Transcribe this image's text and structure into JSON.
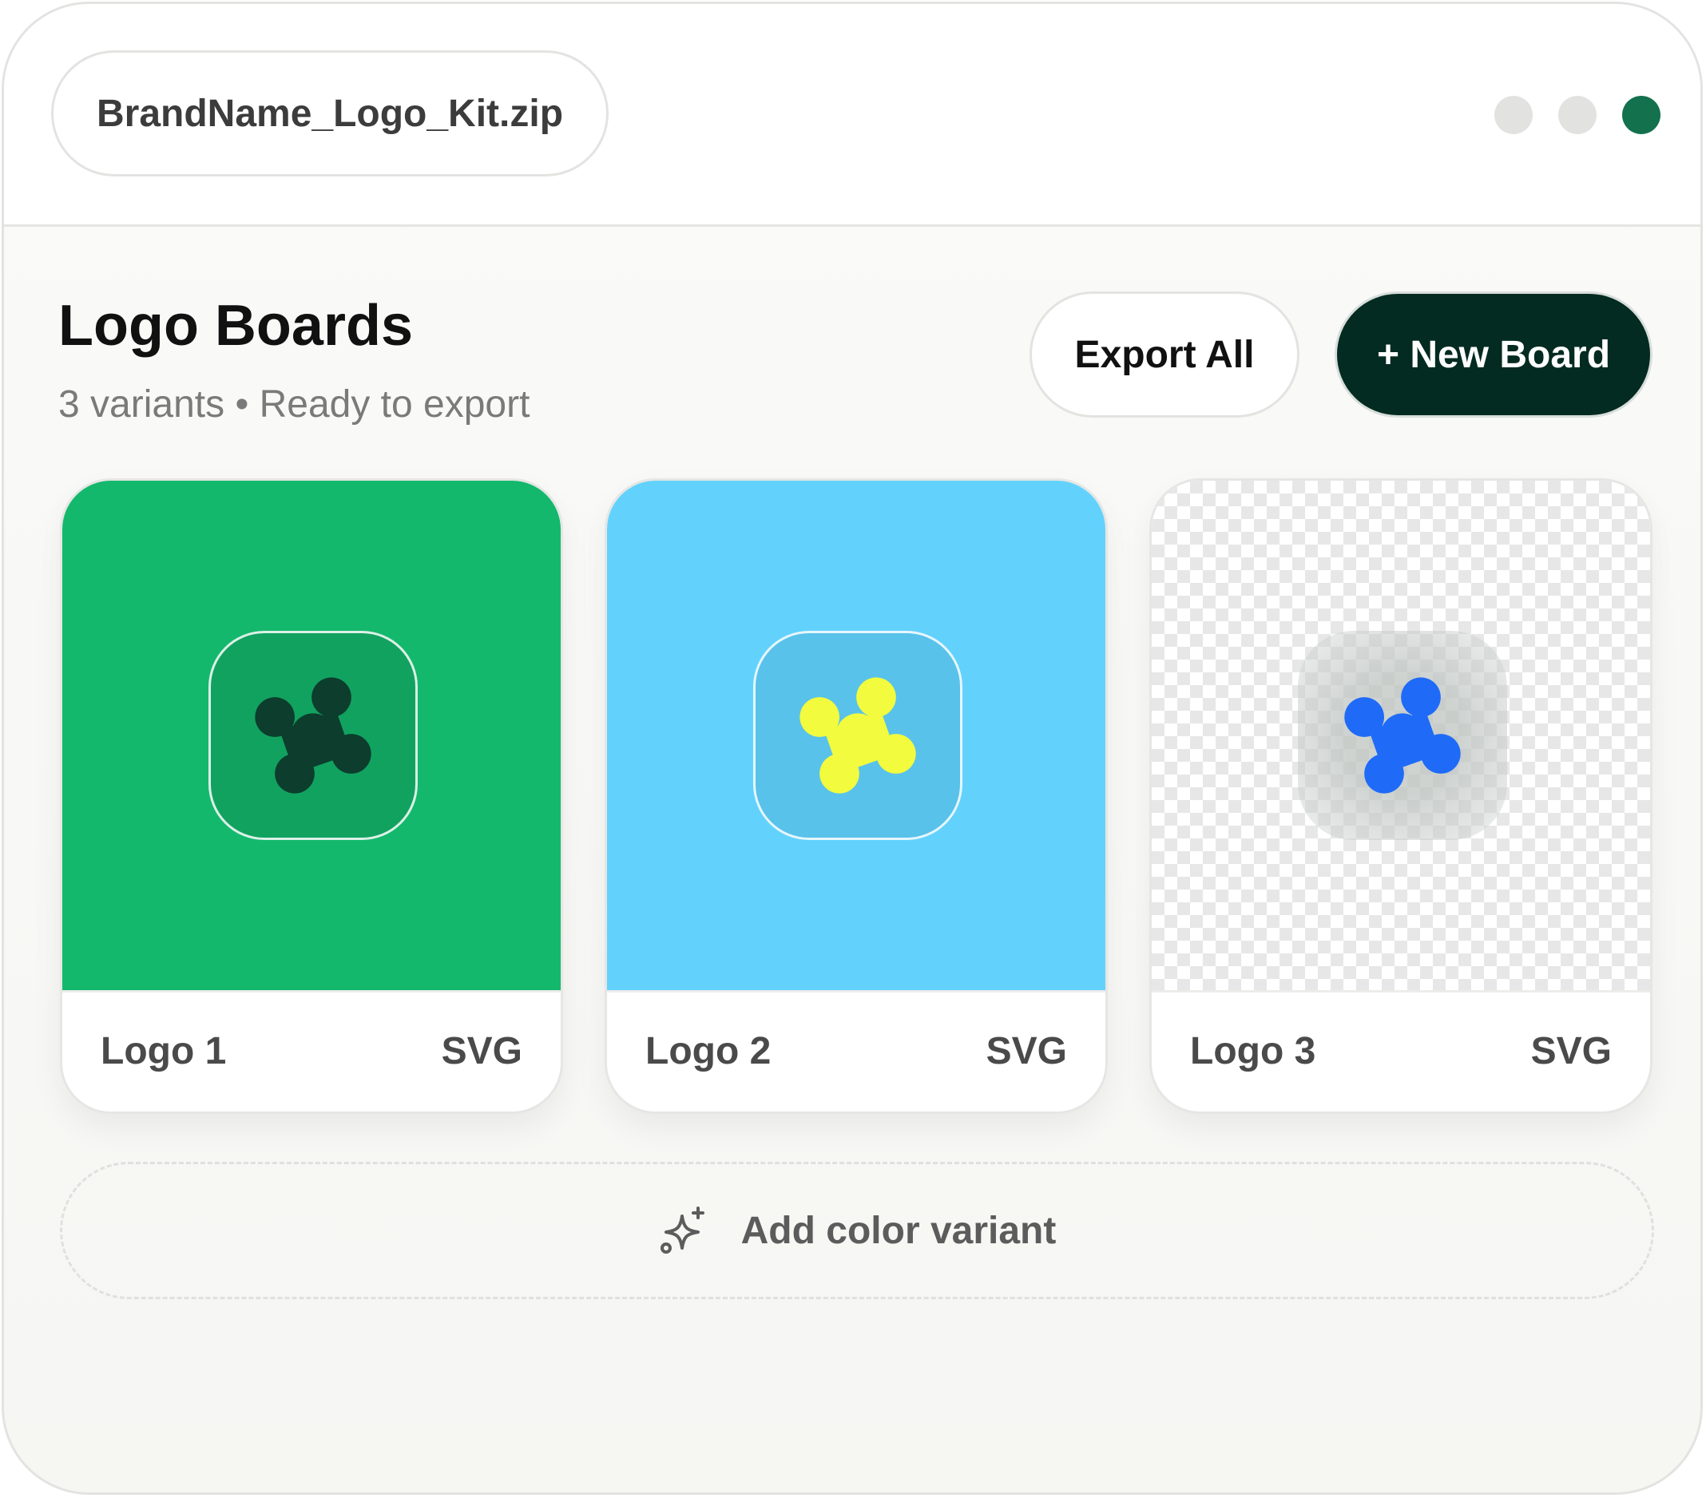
{
  "titlebar": {
    "file_name": "BrandName_Logo_Kit.zip",
    "dots": [
      "#e2e2e0",
      "#e2e2e0",
      "#13714e"
    ]
  },
  "header": {
    "title": "Logo Boards",
    "subtitle": "3 variants • Ready to export",
    "export_label": "Export All",
    "new_board_label": "+ New Board"
  },
  "boards": [
    {
      "name": "Logo 1",
      "format": "SVG",
      "background": "#13b86c",
      "tile_color": "#12a260",
      "mark_color": "#0c3d2d"
    },
    {
      "name": "Logo 2",
      "format": "SVG",
      "background": "#62d2fd",
      "tile_color": "#58c2ea",
      "mark_color": "#f2fb3e"
    },
    {
      "name": "Logo 3",
      "format": "SVG",
      "background": "transparent",
      "tile_color": "#d7dbd9",
      "mark_color": "#1f6bf7"
    }
  ],
  "add_variant": {
    "label": "Add color variant",
    "icon": "sparkle-icon"
  },
  "colors": {
    "accent_dark": "#032b21",
    "accent_green": "#13714e"
  }
}
